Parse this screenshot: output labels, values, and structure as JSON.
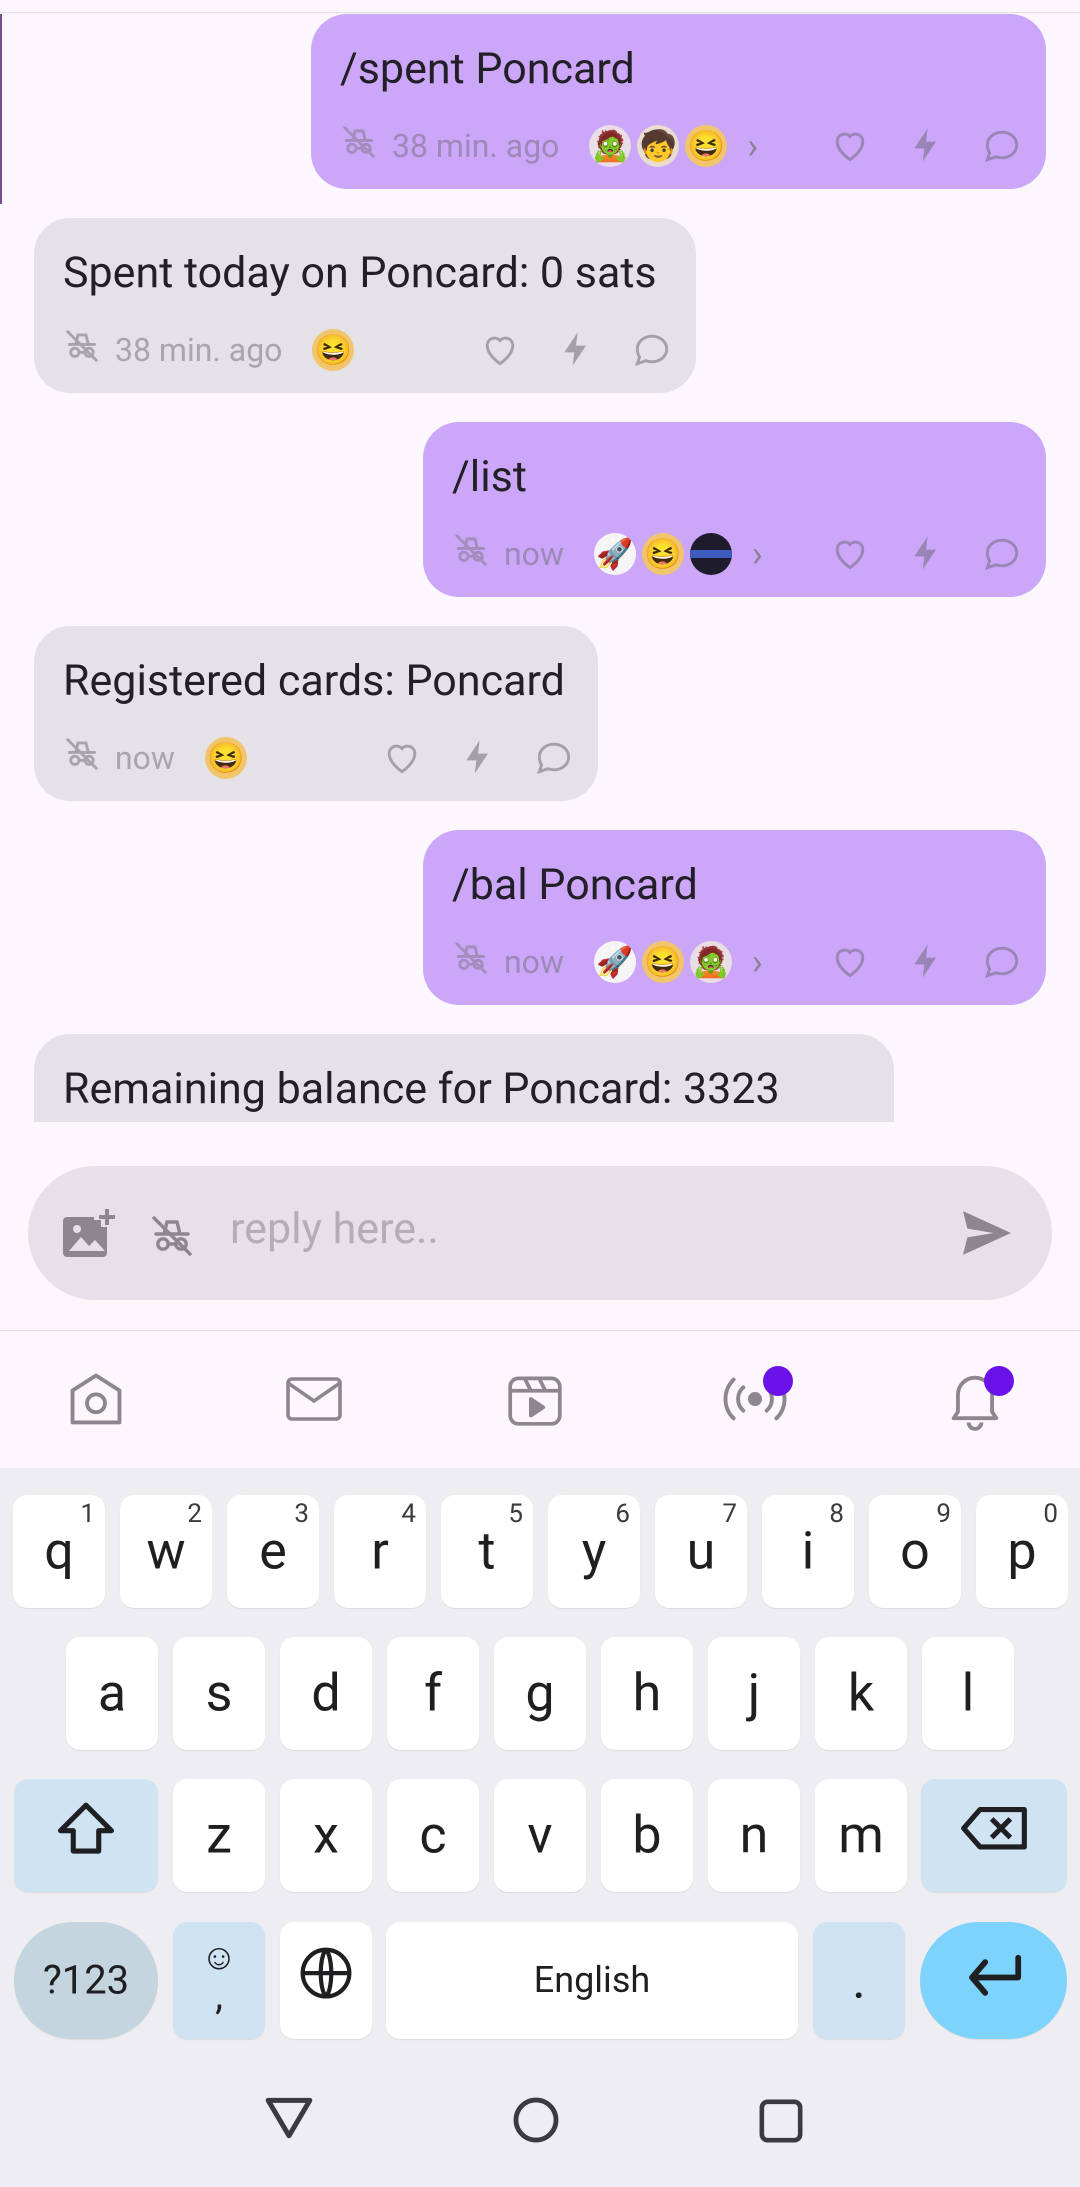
{
  "messages": [
    {
      "side": "out",
      "text": "/spent Poncard",
      "time": "38 min. ago",
      "reactors": [
        "zombie-avatar",
        "kid-avatar",
        "laughing-avatar"
      ],
      "more": true
    },
    {
      "side": "in",
      "text": "Spent today on Poncard: 0 sats",
      "time": "38 min. ago",
      "reactors": [
        "laughing-avatar"
      ],
      "more": false
    },
    {
      "side": "out",
      "text": "/list",
      "time": "now",
      "reactors": [
        "rocket-avatar",
        "laughing-avatar",
        "dark-avatar"
      ],
      "more": true
    },
    {
      "side": "in",
      "text": "Registered cards: Poncard",
      "time": "now",
      "reactors": [
        "laughing-avatar"
      ],
      "more": false
    },
    {
      "side": "out",
      "text": "/bal Poncard",
      "time": "now",
      "reactors": [
        "rocket-avatar",
        "laughing-avatar",
        "zombie-avatar"
      ],
      "more": true
    },
    {
      "side": "in",
      "text": "Remaining balance for Poncard: 3323",
      "time": "",
      "reactors": [],
      "more": false
    }
  ],
  "composer": {
    "placeholder": "reply here.."
  },
  "bottom_nav": {
    "items": [
      "home-icon",
      "messages-icon",
      "videos-icon",
      "live-broadcast-icon",
      "notifications-icon"
    ],
    "badges": {
      "live-broadcast-icon": true,
      "notifications-icon": true
    }
  },
  "keyboard": {
    "row1": [
      {
        "k": "q",
        "h": "1"
      },
      {
        "k": "w",
        "h": "2"
      },
      {
        "k": "e",
        "h": "3"
      },
      {
        "k": "r",
        "h": "4"
      },
      {
        "k": "t",
        "h": "5"
      },
      {
        "k": "y",
        "h": "6"
      },
      {
        "k": "u",
        "h": "7"
      },
      {
        "k": "i",
        "h": "8"
      },
      {
        "k": "o",
        "h": "9"
      },
      {
        "k": "p",
        "h": "0"
      }
    ],
    "row2": [
      "a",
      "s",
      "d",
      "f",
      "g",
      "h",
      "j",
      "k",
      "l"
    ],
    "row3": [
      "z",
      "x",
      "c",
      "v",
      "b",
      "n",
      "m"
    ],
    "sym_label": "?123",
    "emoji_sub": ",",
    "space_label": "English",
    "period_label": "."
  },
  "colors": {
    "outgoing_bubble": "#cca6f8",
    "incoming_bubble": "#e4e2e6",
    "accent": "#6a12e8",
    "enter_key": "#7dd3fc"
  }
}
